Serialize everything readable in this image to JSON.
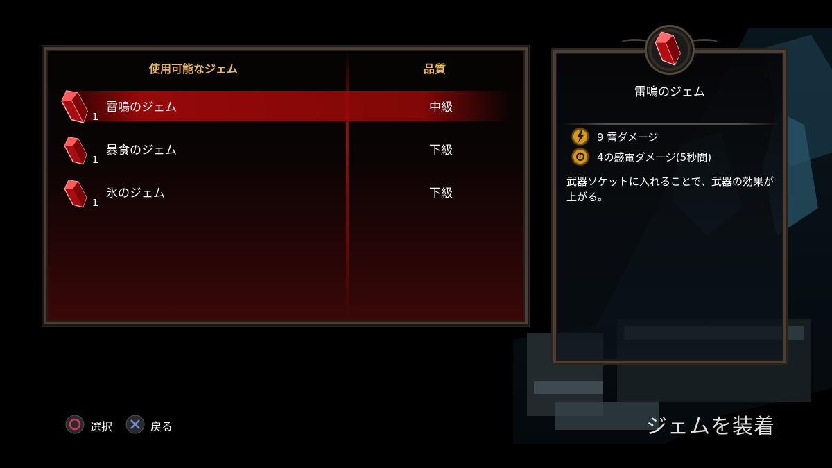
{
  "list": {
    "header_name": "使用可能なジェム",
    "header_quality": "品質",
    "items": [
      {
        "name": "雷鳴のジェム",
        "count": "1",
        "quality": "中級",
        "selected": true,
        "icon": "red-gem-icon"
      },
      {
        "name": "暴食のジェム",
        "count": "1",
        "quality": "下級",
        "selected": false,
        "icon": "red-gem-icon"
      },
      {
        "name": "氷のジェム",
        "count": "1",
        "quality": "下級",
        "selected": false,
        "icon": "red-gem-icon"
      }
    ]
  },
  "detail": {
    "title": "雷鳴のジェム",
    "icon": "red-gem-icon",
    "stats": [
      {
        "icon": "lightning-orb-icon",
        "text": "9 雷ダメージ"
      },
      {
        "icon": "shock-orb-icon",
        "text": "4の感電ダメージ(5秒間)"
      }
    ],
    "description": "武器ソケットに入れることで、武器の効果が上がる。"
  },
  "footer": {
    "select_label": "選択",
    "select_icon": "circle-button-icon",
    "back_label": "戻る",
    "back_icon": "cross-button-icon",
    "screen_title": "ジェムを装着"
  },
  "colors": {
    "header": "#e7b75f",
    "selection": "#af0a0a",
    "panel_border": "#4a3f36"
  }
}
